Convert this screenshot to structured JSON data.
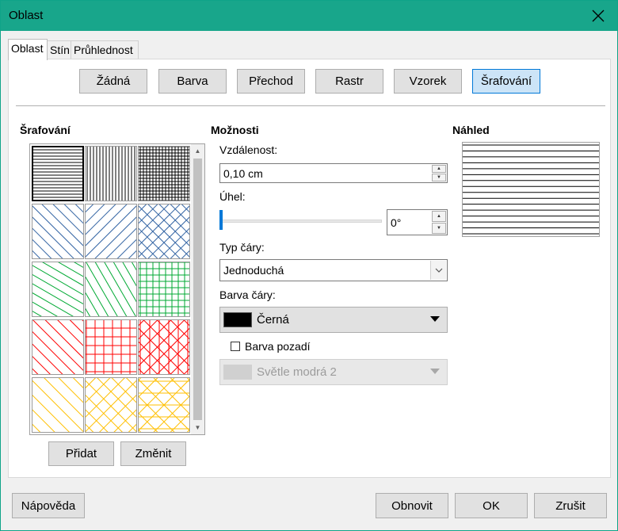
{
  "window": {
    "title": "Oblast"
  },
  "tabs": [
    {
      "label": "Oblast",
      "active": true
    },
    {
      "label": "Stín",
      "active": false
    },
    {
      "label": "Průhlednost",
      "active": false
    }
  ],
  "fill_buttons": [
    {
      "label": "Žádná",
      "selected": false
    },
    {
      "label": "Barva",
      "selected": false
    },
    {
      "label": "Přechod",
      "selected": false
    },
    {
      "label": "Rastr",
      "selected": false
    },
    {
      "label": "Vzorek",
      "selected": false
    },
    {
      "label": "Šrafování",
      "selected": true
    }
  ],
  "hatching": {
    "title": "Šrafování",
    "patterns": [
      {
        "name": "Black 0 Degrees",
        "color": "#000000",
        "selected": true
      },
      {
        "name": "Black 90 Degrees",
        "color": "#000000",
        "selected": false
      },
      {
        "name": "Black 0/90 Crossed",
        "color": "#000000",
        "selected": false
      },
      {
        "name": "Blue 45 Degrees",
        "color": "#3465a4",
        "selected": false
      },
      {
        "name": "Blue -45 Degrees",
        "color": "#3465a4",
        "selected": false
      },
      {
        "name": "Blue 45 Crossed",
        "color": "#3465a4",
        "selected": false
      },
      {
        "name": "Green 30 Degrees",
        "color": "#00a933",
        "selected": false
      },
      {
        "name": "Green 60 Degrees",
        "color": "#00a933",
        "selected": false
      },
      {
        "name": "Green 90 Crossed",
        "color": "#00a933",
        "selected": false
      },
      {
        "name": "Red 45 Degrees",
        "color": "#ff0000",
        "selected": false
      },
      {
        "name": "Red 90 Crossed",
        "color": "#ff0000",
        "selected": false
      },
      {
        "name": "Red Triple 45 Degrees",
        "color": "#ff0000",
        "selected": false
      },
      {
        "name": "Yellow 45 Degrees",
        "color": "#ffbf00",
        "selected": false
      },
      {
        "name": "Yellow 45 Crossed",
        "color": "#ffbf00",
        "selected": false
      },
      {
        "name": "Yellow Triple 90 Degrees",
        "color": "#ffbf00",
        "selected": false
      }
    ],
    "add_label": "Přidat",
    "modify_label": "Změnit"
  },
  "options": {
    "title": "Možnosti",
    "spacing_label": "Vzdálenost:",
    "spacing_value": "0,10 cm",
    "angle_label": "Úhel:",
    "angle_value": "0°",
    "line_type_label": "Typ čáry:",
    "line_type_value": "Jednoduchá",
    "line_color_label": "Barva čáry:",
    "line_color_value": "Černá",
    "line_color_hex": "#000000",
    "background_label": "Barva pozadí",
    "background_checked": false,
    "background_color_value": "Světle modrá 2",
    "background_color_hex": "#d0d0d0"
  },
  "preview": {
    "title": "Náhled",
    "line_count": 16
  },
  "footer": {
    "help_label": "Nápověda",
    "reset_label": "Obnovit",
    "ok_label": "OK",
    "cancel_label": "Zrušit"
  },
  "colors": {
    "titlebar": "#18a68b",
    "selected_button": "#cce4f7",
    "accent": "#0078d7"
  }
}
